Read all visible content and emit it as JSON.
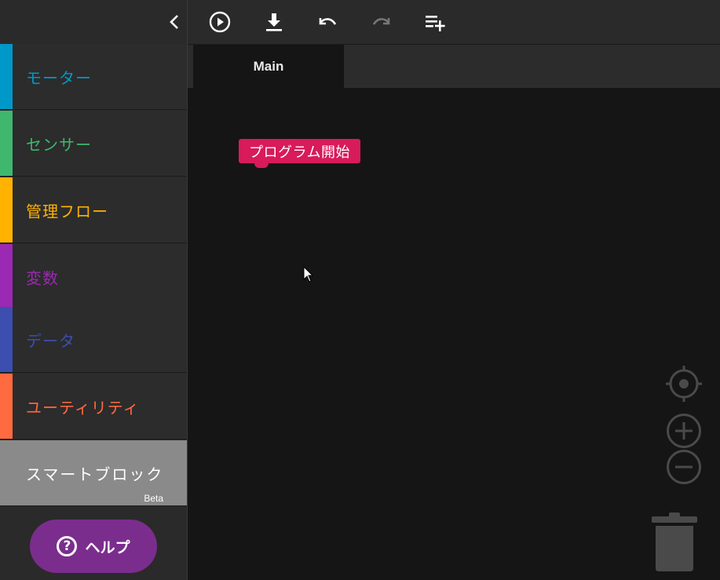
{
  "sidebar": {
    "categories": [
      {
        "label": "モーター",
        "color": "#0097c9"
      },
      {
        "label": "センサー",
        "color": "#3fb86e"
      },
      {
        "label": "管理フロー",
        "color": "#ffb300"
      },
      {
        "label": "変数",
        "color": "#9b29b3"
      },
      {
        "label": "データ",
        "color": "#3c4eb0"
      },
      {
        "label": "ユーティリティ",
        "color": "#ff6a40"
      },
      {
        "label": "スマートブロック",
        "badge": "Beta",
        "color": "#8a8a8a"
      }
    ],
    "help_label": "ヘルプ"
  },
  "toolbar": {
    "icons": [
      "chevron-left-icon",
      "play-circle-icon",
      "download-icon",
      "undo-icon",
      "redo-icon",
      "playlist-add-icon"
    ]
  },
  "tabs": [
    {
      "label": "Main",
      "active": true
    }
  ],
  "canvas": {
    "start_block_label": "プログラム開始",
    "start_block_color": "#d81b5a",
    "controls": [
      "recenter-icon",
      "zoom-in-icon",
      "zoom-out-icon",
      "trash-icon"
    ]
  }
}
